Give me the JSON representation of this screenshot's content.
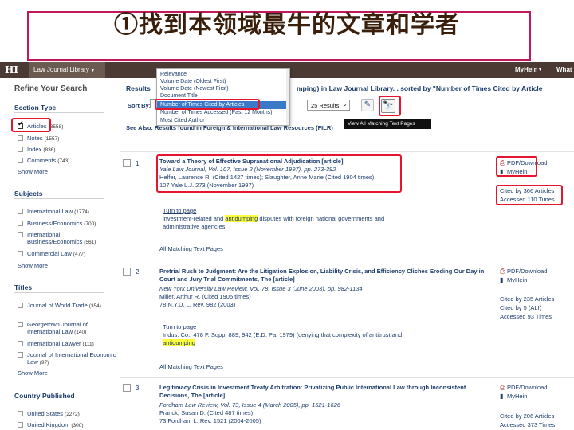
{
  "slide": {
    "title": "①找到本领域最牛的文章和学者"
  },
  "appbar": {
    "logo": "HI",
    "library_tab": "Law Journal Library",
    "library_caret": "▾",
    "myhein": "MyHein",
    "myhein_caret": "▾",
    "whats": "What"
  },
  "sidebar": {
    "refine_title": "Refine Your Search",
    "section_type": {
      "heading": "Section Type",
      "items": [
        {
          "label": "Articles",
          "count": "(3558)",
          "checked": true
        },
        {
          "label": "Notes",
          "count": "(1557)",
          "checked": false
        },
        {
          "label": "Index",
          "count": "(836)",
          "checked": false
        },
        {
          "label": "Comments",
          "count": "(743)",
          "checked": false
        }
      ],
      "show_more": "Show More"
    },
    "subjects": {
      "heading": "Subjects",
      "items": [
        {
          "label": "International Law",
          "count": "(1774)"
        },
        {
          "label": "Business/Economics",
          "count": "(700)"
        },
        {
          "label": "International Business/Economics",
          "count": "(561)"
        },
        {
          "label": "Commercial Law",
          "count": "(477)"
        }
      ],
      "show_more": "Show More"
    },
    "titles": {
      "heading": "Titles",
      "items": [
        {
          "label": "Journal of World Trade",
          "count": "(354)"
        },
        {
          "label": "Georgetown Journal of International Law",
          "count": "(140)"
        },
        {
          "label": "International Lawyer",
          "count": "(111)"
        },
        {
          "label": "Journal of International Economic Law",
          "count": "(97)"
        }
      ],
      "show_more": "Show More"
    },
    "country": {
      "heading": "Country Published",
      "items": [
        {
          "label": "United States",
          "count": "(2272)"
        },
        {
          "label": "United Kingdom",
          "count": "(300)"
        }
      ]
    }
  },
  "main": {
    "results_header_left": "Results",
    "results_header_right": "mping) in Law Journal Library. . sorted by \"Number of Times Cited by Article",
    "sort_by_label": "Sort By:",
    "results_per_page": "25 Results",
    "results_chevron": "⌄",
    "edit_icon": "✎",
    "search_icon": "🔭",
    "tooltip": "View All Matching Text Pages",
    "see_also": "See Also: Results found in Foreign & International Law Resources (FILR)",
    "sort_options": [
      "Relevance",
      "Volume Date (Oldest First)",
      "Volume Date (Newest First)",
      "Document Title",
      "Number of Times Cited by Articles",
      "Number of Times Accessed (Past 12 Months)",
      "Most Cited Author"
    ],
    "selected_sort_index": 4
  },
  "results": [
    {
      "num": "1.",
      "title": "Toward a Theory of Effective Supranational Adjudication [article]",
      "lines": [
        "Yale Law Journal, Vol. 107, Issue 2 (November 1997), pp. 273-392",
        "Helfer, Laurence R. (Cited 1427 times); Slaughter, Anne Marie (Cited 1904 times)",
        "107 Yale L.J. 273 (November 1997)"
      ],
      "turn_to_page": "Turn to page",
      "snippet_before": "investment-related and ",
      "snippet_hl": "antidumping",
      "snippet_after": " disputes with foreign national governments and administrative agencies",
      "all_text": "All Matching Text Pages",
      "pdf": "PDF/Download",
      "myhein": "MyHein",
      "cited_articles": "Cited by 366 Articles",
      "accessed": "Accessed 110 Times"
    },
    {
      "num": "2.",
      "title": "Pretrial Rush to Judgment: Are the Litigation Explosion, Liability Crisis, and Efficiency Cliches Eroding Our Day in Court and Jury Trial Commitments, The [article]",
      "lines": [
        "New York University Law Review, Vol. 78, Issue 3 (June 2003), pp. 982-1134",
        "Miller, Arthur R. (Cited 1905 times)",
        "78 N.Y.U. L. Rev. 982 (2003)"
      ],
      "turn_to_page": "Turn to page",
      "snippet_before": "Indus. Co., 478 F. Supp. 889, 942 (E.D. Pa. 1979) (denying that complexity of antitrust and ",
      "snippet_hl": "antidumping",
      "snippet_after": "",
      "all_text": "All Matching Text Pages",
      "pdf": "PDF/Download",
      "myhein": "MyHein",
      "cited_articles": "Cited by 235 Articles",
      "cited_ali": "Cited by 5 (ALI)",
      "accessed": "Accessed 93 Times"
    },
    {
      "num": "3.",
      "title": "Legitimacy Crisis in Investment Treaty Arbitration: Privatizing Public International Law through Inconsistent Decisions, The [article]",
      "lines": [
        "Fordham Law Review, Vol. 73, Issue 4 (March 2005), pp. 1521-1626",
        "Franck, Susan D. (Cited 487 times)",
        "73 Fordham L. Rev. 1521 (2004-2005)"
      ],
      "pdf": "PDF/Download",
      "myhein": "MyHein",
      "cited_articles": "Cited by 206 Articles",
      "accessed": "Accessed 373 Times"
    }
  ],
  "icons": {
    "pdf": "pdf-icon",
    "bookmark": "bookmark-icon",
    "check": "checkmark-icon"
  },
  "colors": {
    "annotation_red": "#e8142d",
    "title_border": "#c2185b",
    "link_blue": "#1d3d6b",
    "appbar": "#4a3a33",
    "highlight": "#ffff3a",
    "selected_option": "#3a78c8"
  }
}
